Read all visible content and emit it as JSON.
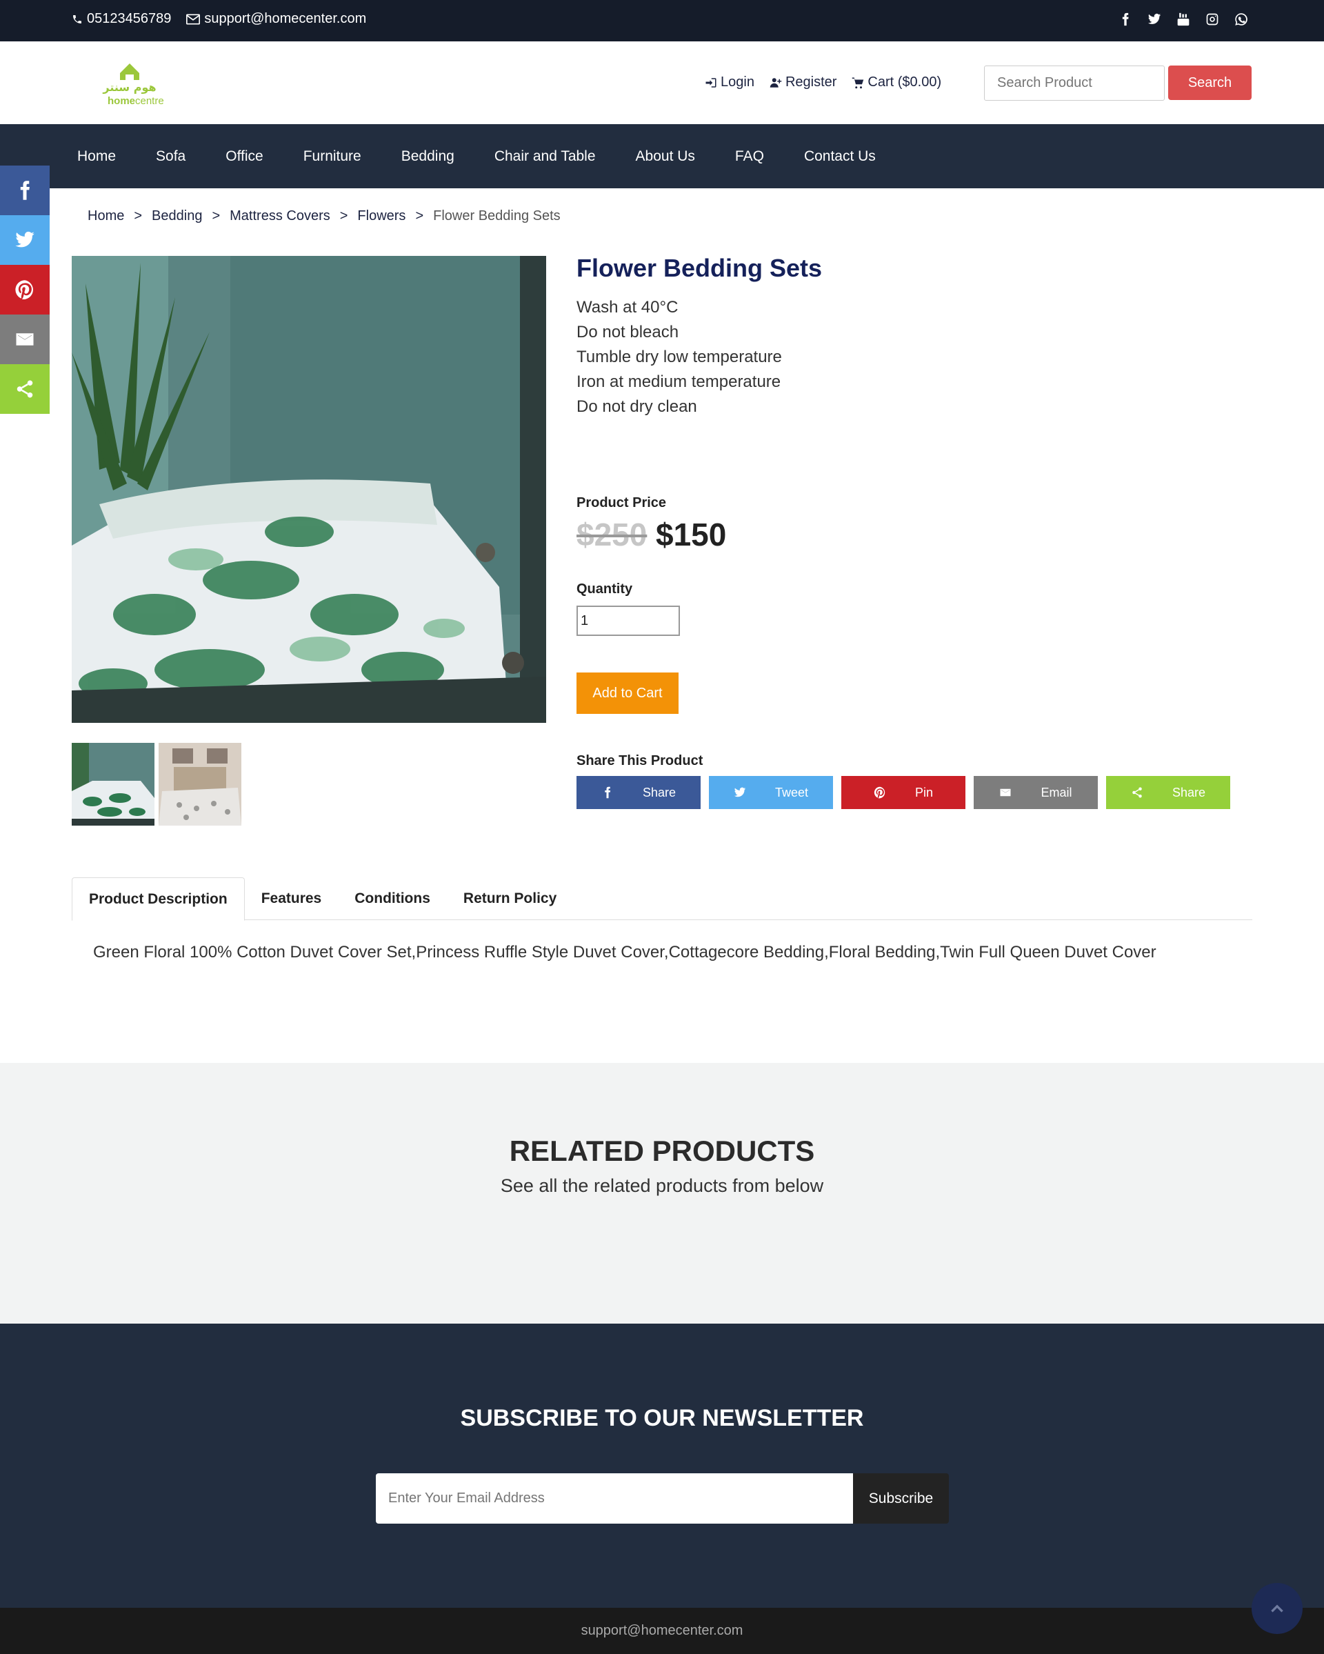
{
  "topbar": {
    "phone": "05123456789",
    "email": "support@homecenter.com",
    "socials": [
      "facebook-icon",
      "twitter-icon",
      "youtube-icon",
      "instagram-icon",
      "whatsapp-icon"
    ]
  },
  "header": {
    "logo_arabic": "هوم سنتر",
    "logo_home": "home",
    "logo_centre": "centre",
    "login": "Login",
    "register": "Register",
    "cart": "Cart ($0.00)",
    "search_placeholder": "Search Product",
    "search_button": "Search"
  },
  "nav": [
    "Home",
    "Sofa",
    "Office",
    "Furniture",
    "Bedding",
    "Chair and Table",
    "About Us",
    "FAQ",
    "Contact Us"
  ],
  "breadcrumb": [
    "Home",
    "Bedding",
    "Mattress Covers",
    "Flowers",
    "Flower Bedding Sets"
  ],
  "breadcrumb_sep": ">",
  "product": {
    "title": "Flower Bedding Sets",
    "specs": [
      "Wash at 40°C",
      "Do not bleach",
      "Tumble dry low temperature",
      "Iron at medium temperature",
      "Do not dry clean"
    ],
    "price_label": "Product Price",
    "old_price": "$250",
    "new_price": "$150",
    "quantity_label": "Quantity",
    "quantity_value": "1",
    "add_to_cart": "Add to Cart",
    "share_label": "Share This Product",
    "share_buttons": [
      {
        "label": "Share",
        "color": "#3b5998",
        "icon": "facebook-icon"
      },
      {
        "label": "Tweet",
        "color": "#55acee",
        "icon": "twitter-icon"
      },
      {
        "label": "Pin",
        "color": "#cb2027",
        "icon": "pinterest-icon"
      },
      {
        "label": "Email",
        "color": "#7d7d7d",
        "icon": "email-icon"
      },
      {
        "label": "Share",
        "color": "#95d03a",
        "icon": "share-icon"
      }
    ]
  },
  "tabs": {
    "items": [
      "Product Description",
      "Features",
      "Conditions",
      "Return Policy"
    ],
    "active": "Product Description",
    "content": "Green Floral 100% Cotton Duvet Cover Set,Princess Ruffle Style Duvet Cover,Cottagecore Bedding,Floral Bedding,Twin Full Queen Duvet Cover"
  },
  "related": {
    "title": "RELATED PRODUCTS",
    "subtitle": "See all the related products from below"
  },
  "newsletter": {
    "title": "SUBSCRIBE TO OUR NEWSLETTER",
    "placeholder": "Enter Your Email Address",
    "button": "Subscribe"
  },
  "footer": {
    "email": "support@homecenter.com"
  },
  "colors": {
    "topbar": "#151c2a",
    "nav": "#222d3f",
    "search_button": "#dc4e4e",
    "add_to_cart": "#f39207",
    "title": "#15215a"
  }
}
